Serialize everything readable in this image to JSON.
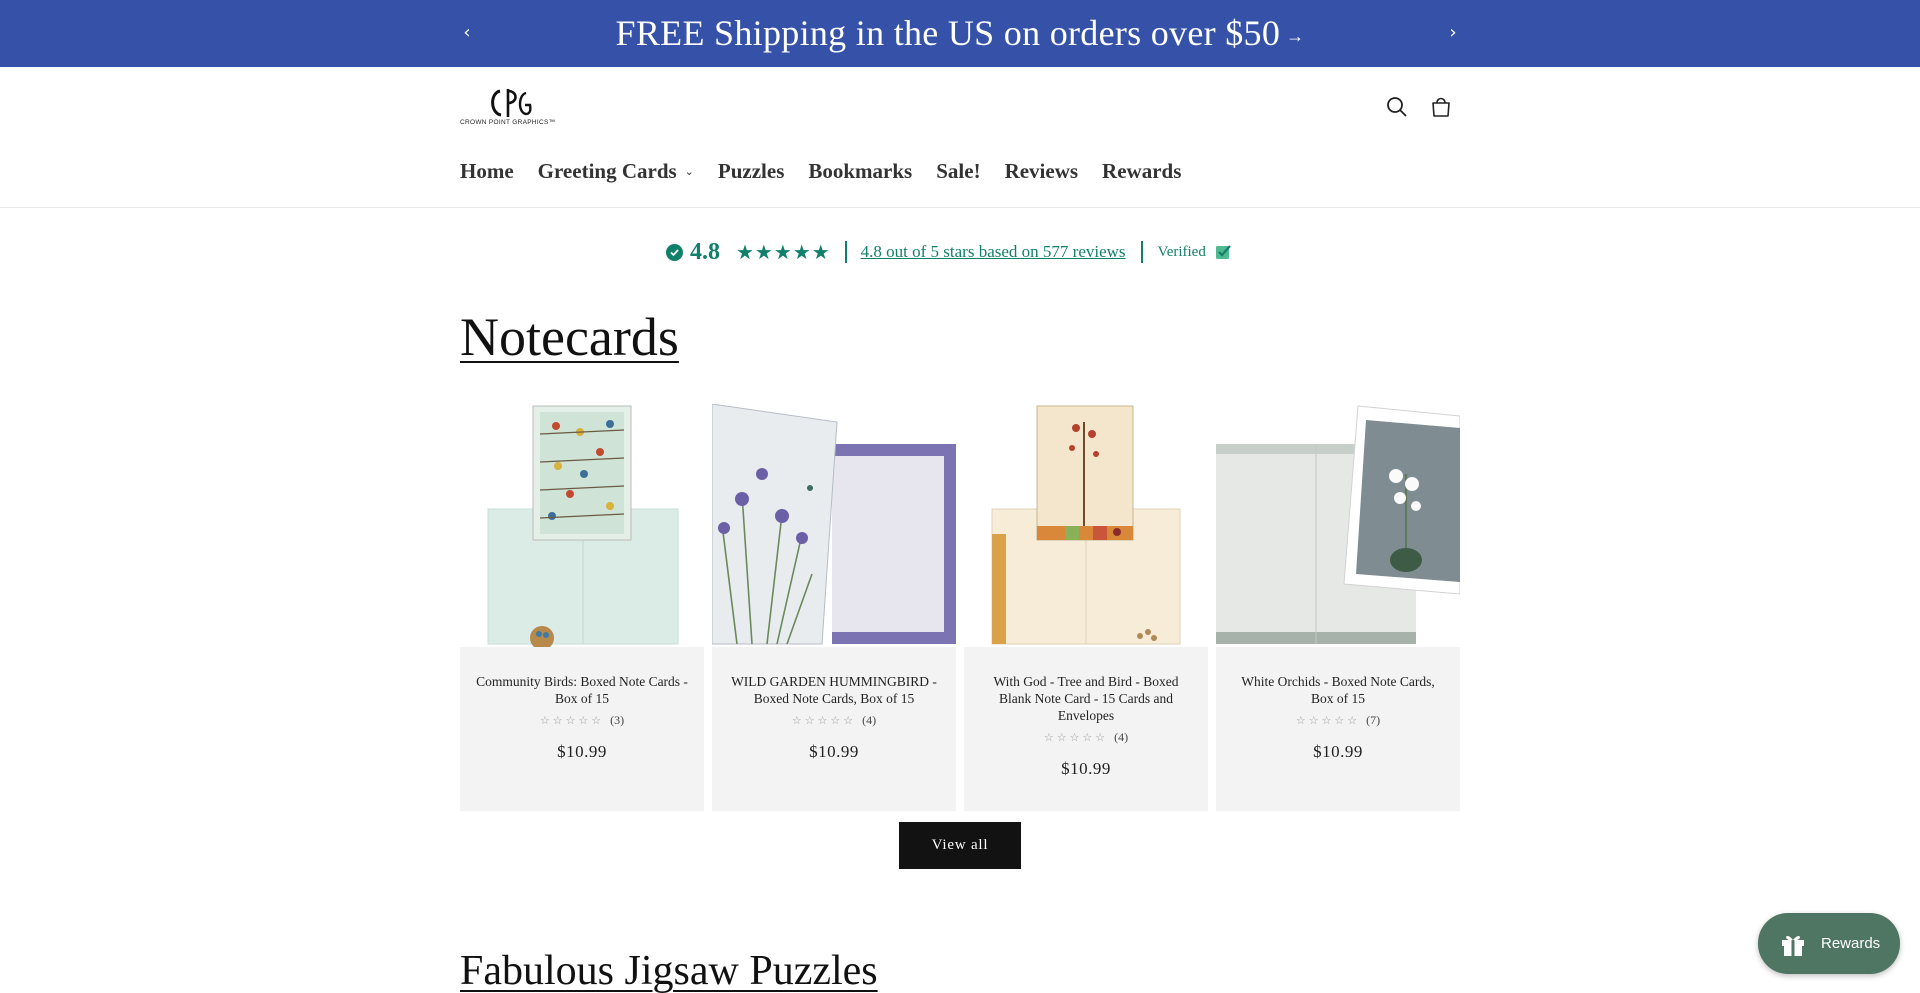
{
  "announcement": {
    "text": "FREE Shipping in the US on orders over $50",
    "arrow": "→",
    "prev_icon": "‹",
    "next_icon": "›"
  },
  "header": {
    "logo_monogram": "CPG",
    "logo_text": "CROWN POINT GRAPHICS™",
    "nav": [
      {
        "label": "Home"
      },
      {
        "label": "Greeting Cards",
        "has_dropdown": true
      },
      {
        "label": "Puzzles"
      },
      {
        "label": "Bookmarks"
      },
      {
        "label": "Sale!"
      },
      {
        "label": "Reviews"
      },
      {
        "label": "Rewards"
      }
    ],
    "icons": [
      "search-icon",
      "cart-icon"
    ]
  },
  "review_bar": {
    "score": "4.8",
    "stars": "★★★★★",
    "summary": "4.8 out of 5 stars based on 577 reviews",
    "verified": "Verified",
    "color": "#11806a"
  },
  "notecards": {
    "title": "Notecards",
    "products": [
      {
        "name": "Community Birds: Boxed Note Cards - Box of 15",
        "stars": "☆☆☆☆☆",
        "count": "(3)",
        "price": "$10.99"
      },
      {
        "name": "WILD GARDEN HUMMINGBIRD - Boxed Note Cards, Box of 15",
        "stars": "☆☆☆☆☆",
        "count": "(4)",
        "price": "$10.99"
      },
      {
        "name": "With God - Tree and Bird - Boxed Blank Note Card - 15 Cards and Envelopes",
        "stars": "☆☆☆☆☆",
        "count": "(4)",
        "price": "$10.99"
      },
      {
        "name": "White Orchids - Boxed Note Cards, Box of 15",
        "stars": "☆☆☆☆☆",
        "count": "(7)",
        "price": "$10.99"
      }
    ],
    "view_all": "View all"
  },
  "puzzles": {
    "title": "Fabulous Jigsaw Puzzles"
  },
  "rewards_widget": {
    "label": "Rewards",
    "icon": "gift-icon",
    "color": "#4f7563"
  },
  "colors": {
    "announcement_bg": "#3552a8",
    "accent_green": "#11806a",
    "button_dark": "#121212"
  }
}
